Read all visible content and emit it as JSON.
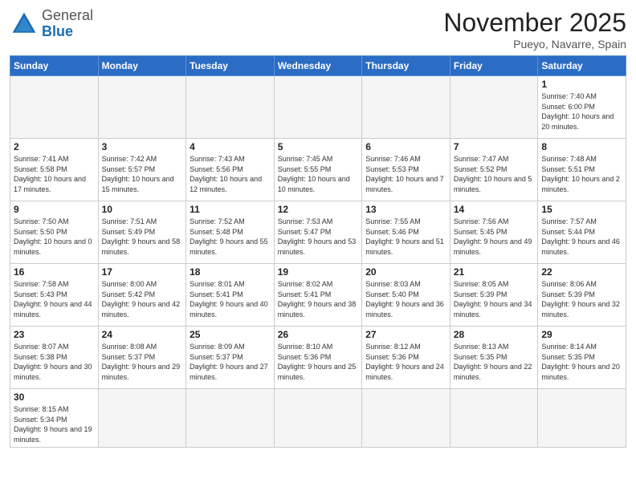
{
  "header": {
    "logo_general": "General",
    "logo_blue": "Blue",
    "month_title": "November 2025",
    "location": "Pueyo, Navarre, Spain"
  },
  "weekdays": [
    "Sunday",
    "Monday",
    "Tuesday",
    "Wednesday",
    "Thursday",
    "Friday",
    "Saturday"
  ],
  "weeks": [
    [
      {
        "day": "",
        "info": ""
      },
      {
        "day": "",
        "info": ""
      },
      {
        "day": "",
        "info": ""
      },
      {
        "day": "",
        "info": ""
      },
      {
        "day": "",
        "info": ""
      },
      {
        "day": "",
        "info": ""
      },
      {
        "day": "1",
        "info": "Sunrise: 7:40 AM\nSunset: 6:00 PM\nDaylight: 10 hours and 20 minutes."
      }
    ],
    [
      {
        "day": "2",
        "info": "Sunrise: 7:41 AM\nSunset: 5:58 PM\nDaylight: 10 hours and 17 minutes."
      },
      {
        "day": "3",
        "info": "Sunrise: 7:42 AM\nSunset: 5:57 PM\nDaylight: 10 hours and 15 minutes."
      },
      {
        "day": "4",
        "info": "Sunrise: 7:43 AM\nSunset: 5:56 PM\nDaylight: 10 hours and 12 minutes."
      },
      {
        "day": "5",
        "info": "Sunrise: 7:45 AM\nSunset: 5:55 PM\nDaylight: 10 hours and 10 minutes."
      },
      {
        "day": "6",
        "info": "Sunrise: 7:46 AM\nSunset: 5:53 PM\nDaylight: 10 hours and 7 minutes."
      },
      {
        "day": "7",
        "info": "Sunrise: 7:47 AM\nSunset: 5:52 PM\nDaylight: 10 hours and 5 minutes."
      },
      {
        "day": "8",
        "info": "Sunrise: 7:48 AM\nSunset: 5:51 PM\nDaylight: 10 hours and 2 minutes."
      }
    ],
    [
      {
        "day": "9",
        "info": "Sunrise: 7:50 AM\nSunset: 5:50 PM\nDaylight: 10 hours and 0 minutes."
      },
      {
        "day": "10",
        "info": "Sunrise: 7:51 AM\nSunset: 5:49 PM\nDaylight: 9 hours and 58 minutes."
      },
      {
        "day": "11",
        "info": "Sunrise: 7:52 AM\nSunset: 5:48 PM\nDaylight: 9 hours and 55 minutes."
      },
      {
        "day": "12",
        "info": "Sunrise: 7:53 AM\nSunset: 5:47 PM\nDaylight: 9 hours and 53 minutes."
      },
      {
        "day": "13",
        "info": "Sunrise: 7:55 AM\nSunset: 5:46 PM\nDaylight: 9 hours and 51 minutes."
      },
      {
        "day": "14",
        "info": "Sunrise: 7:56 AM\nSunset: 5:45 PM\nDaylight: 9 hours and 49 minutes."
      },
      {
        "day": "15",
        "info": "Sunrise: 7:57 AM\nSunset: 5:44 PM\nDaylight: 9 hours and 46 minutes."
      }
    ],
    [
      {
        "day": "16",
        "info": "Sunrise: 7:58 AM\nSunset: 5:43 PM\nDaylight: 9 hours and 44 minutes."
      },
      {
        "day": "17",
        "info": "Sunrise: 8:00 AM\nSunset: 5:42 PM\nDaylight: 9 hours and 42 minutes."
      },
      {
        "day": "18",
        "info": "Sunrise: 8:01 AM\nSunset: 5:41 PM\nDaylight: 9 hours and 40 minutes."
      },
      {
        "day": "19",
        "info": "Sunrise: 8:02 AM\nSunset: 5:41 PM\nDaylight: 9 hours and 38 minutes."
      },
      {
        "day": "20",
        "info": "Sunrise: 8:03 AM\nSunset: 5:40 PM\nDaylight: 9 hours and 36 minutes."
      },
      {
        "day": "21",
        "info": "Sunrise: 8:05 AM\nSunset: 5:39 PM\nDaylight: 9 hours and 34 minutes."
      },
      {
        "day": "22",
        "info": "Sunrise: 8:06 AM\nSunset: 5:39 PM\nDaylight: 9 hours and 32 minutes."
      }
    ],
    [
      {
        "day": "23",
        "info": "Sunrise: 8:07 AM\nSunset: 5:38 PM\nDaylight: 9 hours and 30 minutes."
      },
      {
        "day": "24",
        "info": "Sunrise: 8:08 AM\nSunset: 5:37 PM\nDaylight: 9 hours and 29 minutes."
      },
      {
        "day": "25",
        "info": "Sunrise: 8:09 AM\nSunset: 5:37 PM\nDaylight: 9 hours and 27 minutes."
      },
      {
        "day": "26",
        "info": "Sunrise: 8:10 AM\nSunset: 5:36 PM\nDaylight: 9 hours and 25 minutes."
      },
      {
        "day": "27",
        "info": "Sunrise: 8:12 AM\nSunset: 5:36 PM\nDaylight: 9 hours and 24 minutes."
      },
      {
        "day": "28",
        "info": "Sunrise: 8:13 AM\nSunset: 5:35 PM\nDaylight: 9 hours and 22 minutes."
      },
      {
        "day": "29",
        "info": "Sunrise: 8:14 AM\nSunset: 5:35 PM\nDaylight: 9 hours and 20 minutes."
      }
    ],
    [
      {
        "day": "30",
        "info": "Sunrise: 8:15 AM\nSunset: 5:34 PM\nDaylight: 9 hours and 19 minutes."
      },
      {
        "day": "",
        "info": ""
      },
      {
        "day": "",
        "info": ""
      },
      {
        "day": "",
        "info": ""
      },
      {
        "day": "",
        "info": ""
      },
      {
        "day": "",
        "info": ""
      },
      {
        "day": "",
        "info": ""
      }
    ]
  ]
}
